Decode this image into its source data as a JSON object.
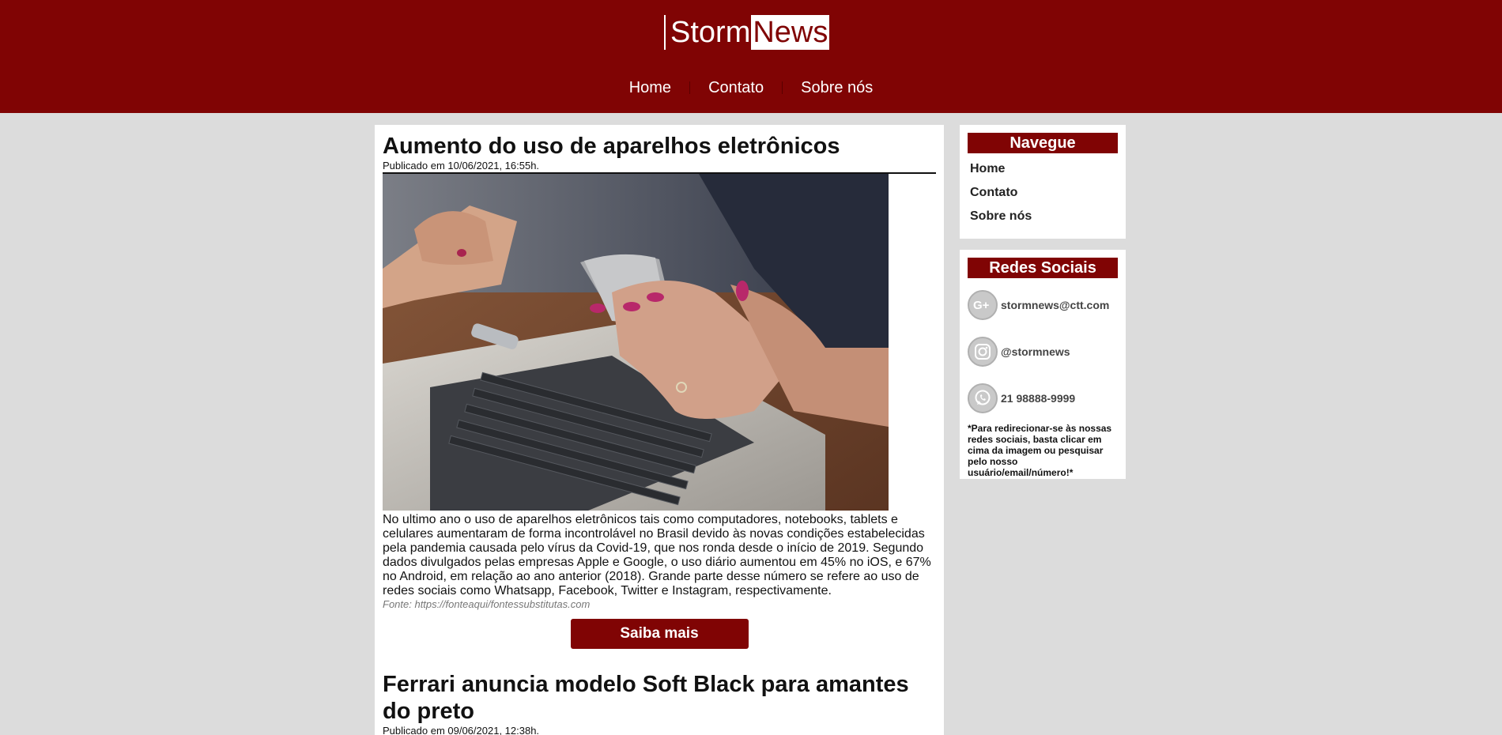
{
  "header": {
    "logo_part1": "Storm",
    "logo_part2": "News",
    "nav": [
      "Home",
      "Contato",
      "Sobre nós"
    ]
  },
  "articles": [
    {
      "title": "Aumento do uso de aparelhos eletrônicos",
      "date": "Publicado em 10/06/2021, 16:55h.",
      "body": "No ultimo ano o uso de aparelhos eletrônicos tais como computadores, notebooks, tablets e celulares aumentaram de forma incontrolável no Brasil devido às novas condições estabelecidas pela pandemia causada pelo vírus da Covid-19, que nos ronda desde o início de 2019. Segundo dados divulgados pelas empresas Apple e Google, o uso diário aumentou em 45% no iOS, e 67% no Android, em relação ao ano anterior (2018). Grande parte desse número se refere ao uso de redes sociais como Whatsapp, Facebook, Twitter e Instagram, respectivamente.",
      "source": "Fonte: https://fonteaqui/fontessubstitutas.com",
      "button": "Saiba mais"
    },
    {
      "title": "Ferrari anuncia modelo Soft Black para amantes do preto",
      "date": "Publicado em 09/06/2021, 12:38h."
    }
  ],
  "sidebar": {
    "nav_title": "Navegue",
    "nav_items": [
      "Home",
      "Contato",
      "Sobre nós"
    ],
    "social_title": "Redes Sociais",
    "social_items": [
      {
        "icon": "google-plus-icon",
        "label": "stormnews@ctt.com"
      },
      {
        "icon": "instagram-icon",
        "label": "@stormnews"
      },
      {
        "icon": "whatsapp-icon",
        "label": "21 98888-9999"
      }
    ],
    "note": "*Para redirecionar-se às nossas redes sociais, basta clicar em cima da imagem ou pesquisar pelo nosso usuário/email/número!*"
  },
  "colors": {
    "brand": "#800404",
    "background": "#dcdcdc"
  }
}
